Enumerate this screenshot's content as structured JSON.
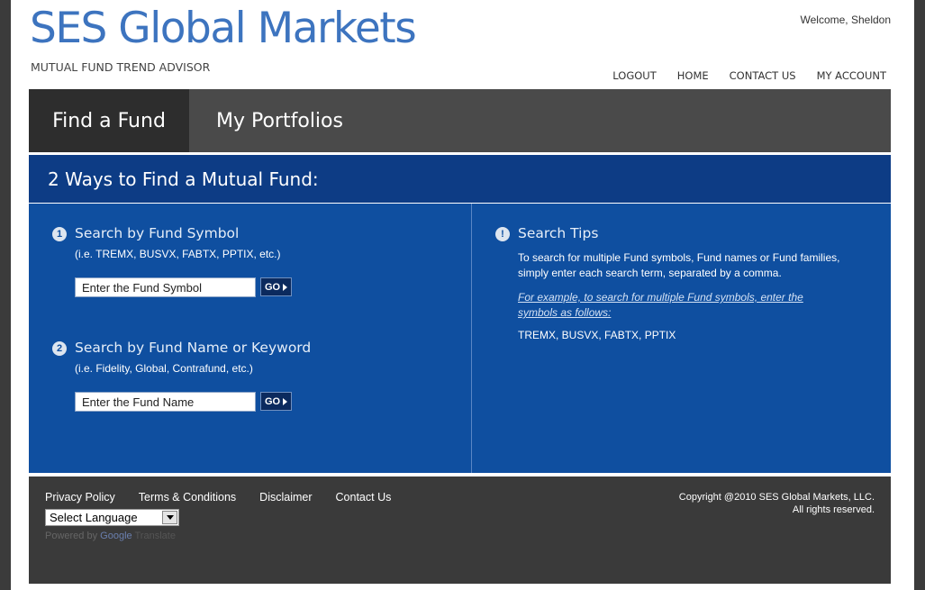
{
  "header": {
    "brand": "SES Global Markets",
    "tagline": "MUTUAL FUND TREND ADVISOR",
    "welcome": "Welcome, Sheldon",
    "nav": [
      "LOGOUT",
      "HOME",
      "CONTACT US",
      "MY ACCOUNT"
    ]
  },
  "tabs": [
    {
      "label": "Find a Fund",
      "active": true
    },
    {
      "label": "My Portfolios",
      "active": false
    }
  ],
  "panel": {
    "heading": "2 Ways to Find a Mutual Fund:",
    "symbol_search": {
      "number": "1",
      "title": "Search by Fund Symbol",
      "example": "(i.e. TREMX, BUSVX, FABTX, PPTIX, etc.)",
      "placeholder": "Enter the Fund Symbol",
      "go": "GO"
    },
    "name_search": {
      "number": "2",
      "title": "Search by Fund Name or Keyword",
      "example": "(i.e. Fidelity, Global, Contrafund, etc.)",
      "placeholder": "Enter the Fund Name",
      "go": "GO"
    },
    "tips": {
      "icon": "!",
      "title": "Search Tips",
      "body": "To search for multiple Fund symbols, Fund names or Fund families, simply enter each search term, separated by a comma.",
      "link": "For example, to search for multiple Fund symbols, enter the symbols as follows:",
      "example": "TREMX, BUSVX, FABTX, PPTIX"
    }
  },
  "footer": {
    "links": [
      "Privacy Policy",
      "Terms & Conditions",
      "Disclaimer",
      "Contact Us"
    ],
    "language_select": "Select Language",
    "powered_by": "Powered by",
    "google": "Google",
    "translate": "Translate",
    "copyright_line1": "Copyright @2010 SES Global Markets, LLC.",
    "copyright_line2": "All rights reserved."
  },
  "colors": {
    "brand_blue": "#3d74bf",
    "panel_header": "#0d3c85",
    "panel_body": "#0f4fa0",
    "tab_bar": "#4a4a4a",
    "tab_active": "#2d2d2d",
    "footer": "#3a3a3a"
  }
}
